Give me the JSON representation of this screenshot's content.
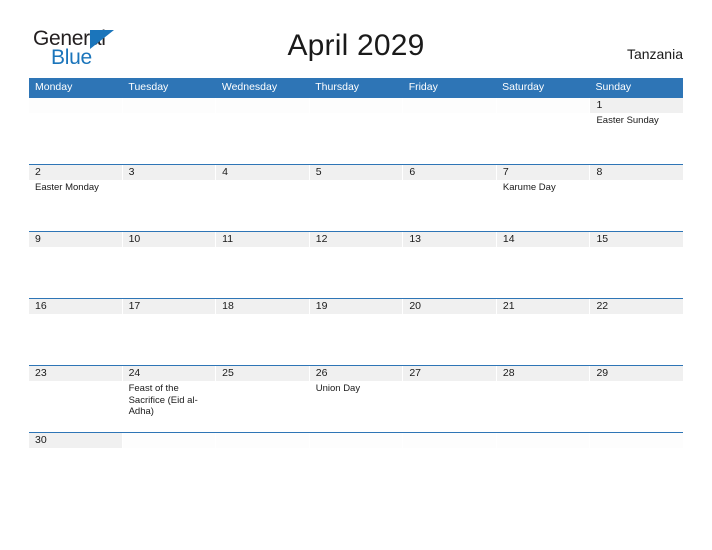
{
  "brand": {
    "name_part1": "General",
    "name_part2": "Blue",
    "triangle_icon": "logo-triangle-icon",
    "color_dark": "#231f20",
    "color_blue": "#1b75bb"
  },
  "header": {
    "title": "April 2029",
    "country": "Tanzania"
  },
  "theme": {
    "header_blue": "#2e75b6",
    "row_border_blue": "#2e75b6",
    "day_band_gray": "#f0f0f0",
    "text_dark": "#1a1a1a"
  },
  "calendar": {
    "weekdays": [
      "Monday",
      "Tuesday",
      "Wednesday",
      "Thursday",
      "Friday",
      "Saturday",
      "Sunday"
    ],
    "weeks": [
      {
        "height": "tall",
        "days": [
          {
            "number": "",
            "events": []
          },
          {
            "number": "",
            "events": []
          },
          {
            "number": "",
            "events": []
          },
          {
            "number": "",
            "events": []
          },
          {
            "number": "",
            "events": []
          },
          {
            "number": "",
            "events": []
          },
          {
            "number": "1",
            "events": [
              "Easter Sunday"
            ]
          }
        ]
      },
      {
        "height": "tall",
        "days": [
          {
            "number": "2",
            "events": [
              "Easter Monday"
            ]
          },
          {
            "number": "3",
            "events": []
          },
          {
            "number": "4",
            "events": []
          },
          {
            "number": "5",
            "events": []
          },
          {
            "number": "6",
            "events": []
          },
          {
            "number": "7",
            "events": [
              "Karume Day"
            ]
          },
          {
            "number": "8",
            "events": []
          }
        ]
      },
      {
        "height": "tall",
        "days": [
          {
            "number": "9",
            "events": []
          },
          {
            "number": "10",
            "events": []
          },
          {
            "number": "11",
            "events": []
          },
          {
            "number": "12",
            "events": []
          },
          {
            "number": "13",
            "events": []
          },
          {
            "number": "14",
            "events": []
          },
          {
            "number": "15",
            "events": []
          }
        ]
      },
      {
        "height": "tall",
        "days": [
          {
            "number": "16",
            "events": []
          },
          {
            "number": "17",
            "events": []
          },
          {
            "number": "18",
            "events": []
          },
          {
            "number": "19",
            "events": []
          },
          {
            "number": "20",
            "events": []
          },
          {
            "number": "21",
            "events": []
          },
          {
            "number": "22",
            "events": []
          }
        ]
      },
      {
        "height": "tall",
        "days": [
          {
            "number": "23",
            "events": []
          },
          {
            "number": "24",
            "events": [
              "Feast of the Sacrifice (Eid al-Adha)"
            ]
          },
          {
            "number": "25",
            "events": []
          },
          {
            "number": "26",
            "events": [
              "Union Day"
            ]
          },
          {
            "number": "27",
            "events": []
          },
          {
            "number": "28",
            "events": []
          },
          {
            "number": "29",
            "events": []
          }
        ]
      },
      {
        "height": "short",
        "days": [
          {
            "number": "30",
            "events": []
          },
          {
            "number": "",
            "events": []
          },
          {
            "number": "",
            "events": []
          },
          {
            "number": "",
            "events": []
          },
          {
            "number": "",
            "events": []
          },
          {
            "number": "",
            "events": []
          },
          {
            "number": "",
            "events": []
          }
        ]
      }
    ]
  }
}
